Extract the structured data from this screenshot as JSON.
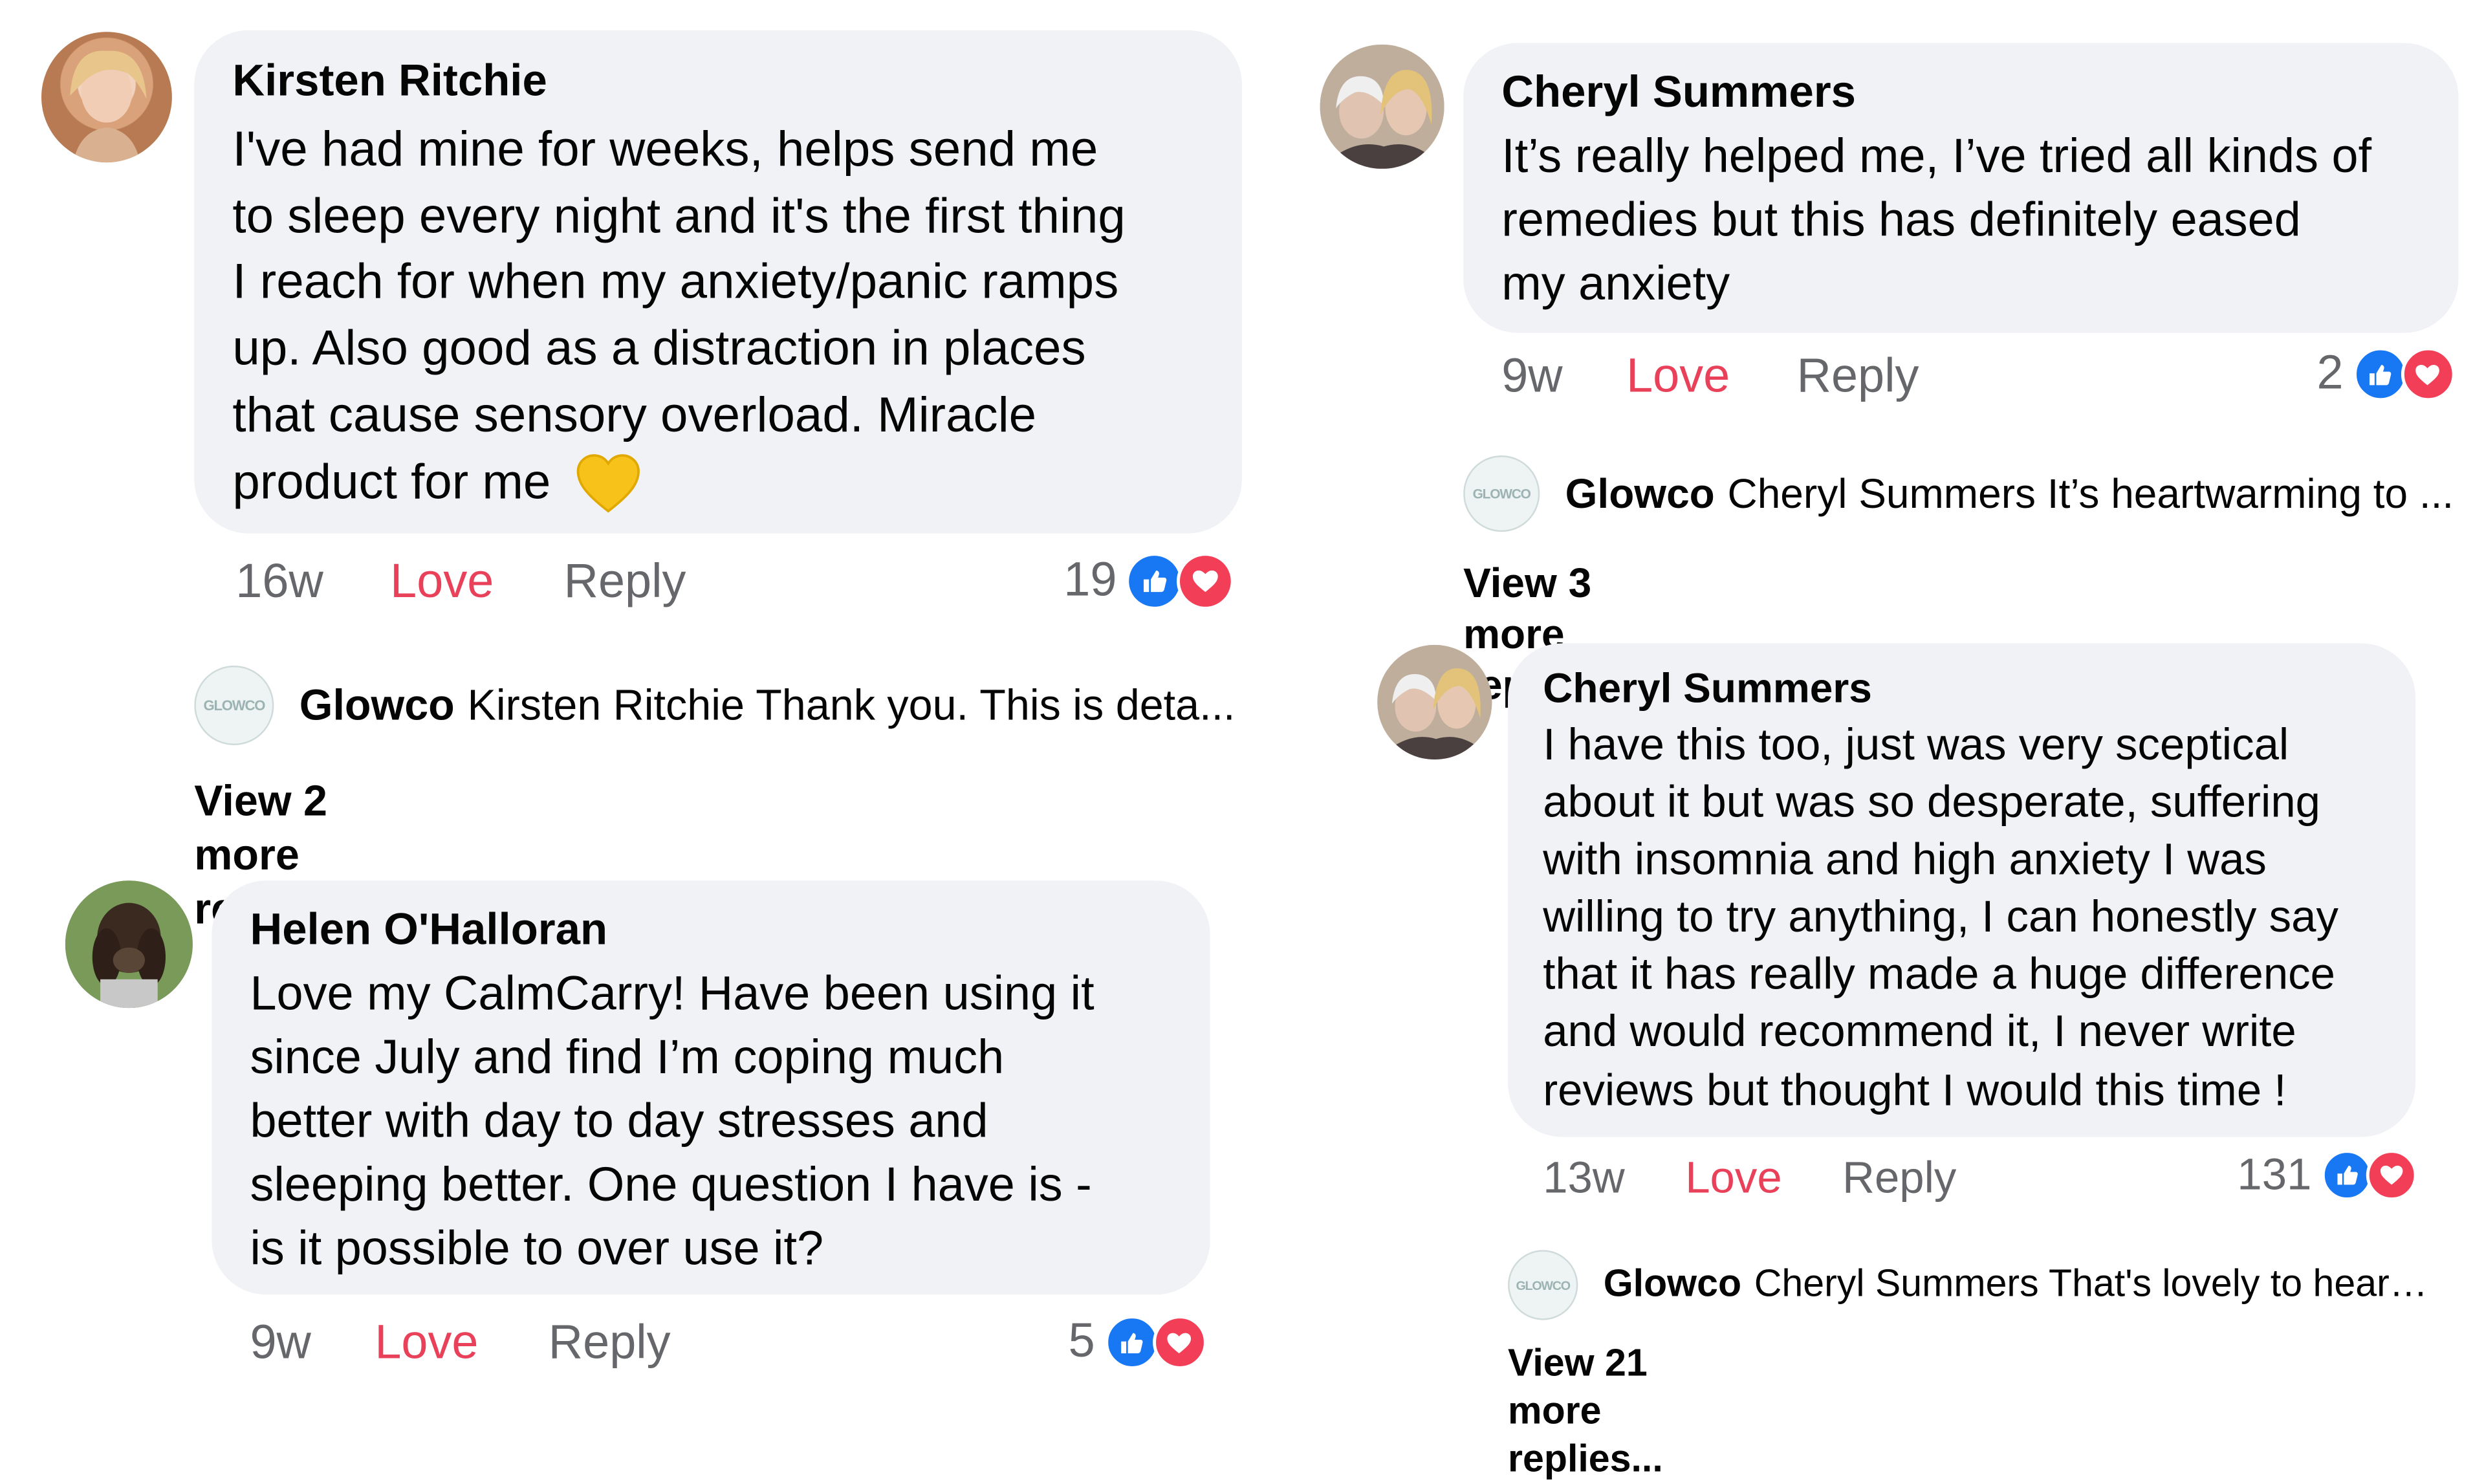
{
  "colors": {
    "bubble": "#f0f2f5",
    "love": "#e9415a",
    "muted": "#65676b",
    "like_blue": "#1877f2",
    "heart_red": "#f33e58"
  },
  "comments": [
    {
      "author": "Kirsten Ritchie",
      "lines": [
        "I've had mine for weeks, helps send me",
        "to sleep every night and it's the first thing",
        "I reach for when my anxiety/panic ramps",
        "up. Also good as a distraction in places",
        "that cause sensory overload. Miracle",
        "product for me"
      ],
      "emoji": "yellow-heart",
      "time": "16w",
      "love": "Love",
      "reply": "Reply",
      "reaction_count": "19",
      "reply_preview": {
        "logo": "GLOWCO",
        "author": "Glowco",
        "text": "Kirsten Ritchie Thank you. This is deta..."
      },
      "view_more": "View 2 more replies..."
    },
    {
      "author": "Helen O'Halloran",
      "lines": [
        "Love my CalmCarry! Have been using it",
        "since July and find I’m coping much",
        "better with day to day stresses and",
        "sleeping better. One question I have is -",
        "is it possible to over use it?"
      ],
      "time": "9w",
      "love": "Love",
      "reply": "Reply",
      "reaction_count": "5"
    },
    {
      "author": "Cheryl Summers",
      "lines": [
        "It’s really helped me, I’ve tried all kinds of",
        "remedies but this has definitely eased",
        "my anxiety"
      ],
      "time": "9w",
      "love": "Love",
      "reply": "Reply",
      "reaction_count": "2",
      "reply_preview": {
        "logo": "GLOWCO",
        "author": "Glowco",
        "text": "Cheryl Summers It’s heartwarming to ..."
      },
      "view_more": "View 3 more replies..."
    },
    {
      "author": "Cheryl Summers",
      "lines": [
        "I have this too, just was very sceptical",
        "about it but was so desperate, suffering",
        "with insomnia and high anxiety I was",
        "willing to try anything, I can honestly say",
        "that it has really made a huge difference",
        "and would recommend it, I never write",
        "reviews but thought I would this time !"
      ],
      "time": "13w",
      "love": "Love",
      "reply": "Reply",
      "reaction_count": "131",
      "reply_preview": {
        "logo": "GLOWCO",
        "author": "Glowco",
        "text": "Cheryl Summers That's lovely to hear! ..."
      },
      "view_more": "View 21 more replies..."
    }
  ]
}
